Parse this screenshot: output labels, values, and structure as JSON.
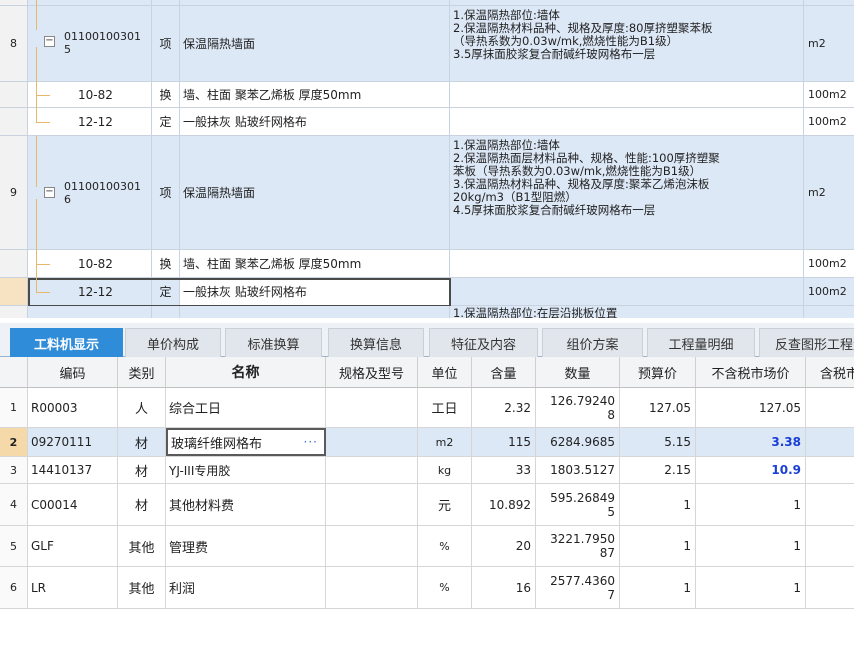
{
  "upper_grid": {
    "top_unit": "m2",
    "rows": [
      {
        "type": "qd",
        "no": "8",
        "code": "011001003015",
        "code_line1": "01100100301",
        "code_line2": "5",
        "cat": "项",
        "name": "保温隔热墙面",
        "features": [
          "1.保温隔热部位:墙体",
          "2.保温隔热材料品种、规格及厚度:80厚挤塑聚苯板",
          "（导热系数为0.03w/mk,燃烧性能为B1级）",
          "3.5厚抹面胶浆复合耐碱纤玻网格布一层"
        ],
        "unit": "m2"
      },
      {
        "type": "de",
        "code": "10-82",
        "cat": "换",
        "name": "墙、柱面 聚苯乙烯板 厚度50mm",
        "unit": "100m2"
      },
      {
        "type": "de",
        "code": "12-12",
        "cat": "定",
        "name": "一般抹灰 贴玻纤网格布",
        "unit": "100m2"
      },
      {
        "type": "qd",
        "no": "9",
        "code_line1": "01100100301",
        "code_line2": "6",
        "cat": "项",
        "name": "保温隔热墙面",
        "features": [
          "1.保温隔热部位:墙体",
          "2.保温隔热面层材料品种、规格、性能:100厚挤塑聚",
          "苯板（导热系数为0.03w/mk,燃烧性能为B1级）",
          "3.保温隔热材料品种、规格及厚度:聚苯乙烯泡沫板",
          "20kg/m3（B1型阻燃）",
          "4.5厚抹面胶浆复合耐碱纤玻网格布一层"
        ],
        "unit": "m2"
      },
      {
        "type": "de",
        "code": "10-82",
        "cat": "换",
        "name": "墙、柱面 聚苯乙烯板 厚度50mm",
        "unit": "100m2"
      },
      {
        "type": "sel",
        "code": "12-12",
        "cat": "定",
        "name": "一般抹灰 贴玻纤网格布",
        "unit": "100m2"
      }
    ],
    "partial_next": "1.保温隔热部位:在层沿挑板位置"
  },
  "tabs": [
    "工料机显示",
    "单价构成",
    "标准换算",
    "换算信息",
    "特征及内容",
    "组价方案",
    "工程量明细",
    "反查图形工程量"
  ],
  "lower_grid": {
    "headers": [
      "编码",
      "类别",
      "名称",
      "规格及型号",
      "单位",
      "含量",
      "数量",
      "预算价",
      "不含税市场价",
      "含税市场价"
    ],
    "rows": [
      {
        "rn": "1",
        "code": "R00003",
        "cat": "人",
        "name": "综合工日",
        "spec": "",
        "unit": "工日",
        "qty": "2.32",
        "amount": "126.792408",
        "amount_l1": "126.79240",
        "amount_l2": "8",
        "budget": "127.05",
        "market": "127.05"
      },
      {
        "rn": "2",
        "code": "09270111",
        "cat": "材",
        "name": "玻璃纤维网格布",
        "spec": "",
        "unit": "m2",
        "qty": "115",
        "amount": "6284.9685",
        "budget": "5.15",
        "market": "3.38"
      },
      {
        "rn": "3",
        "code": "14410137",
        "cat": "材",
        "name": "YJ-III专用胶",
        "spec": "",
        "unit": "kg",
        "qty": "33",
        "amount": "1803.5127",
        "budget": "2.15",
        "market": "10.9"
      },
      {
        "rn": "4",
        "code": "C00014",
        "cat": "材",
        "name": "其他材料费",
        "spec": "",
        "unit": "元",
        "qty": "10.892",
        "amount": "595.268495",
        "amount_l1": "595.26849",
        "amount_l2": "5",
        "budget": "1",
        "market": "1"
      },
      {
        "rn": "5",
        "code": "GLF",
        "cat": "其他",
        "name": "管理费",
        "spec": "",
        "unit": "%",
        "qty": "20",
        "amount": "3221.795087",
        "amount_l1": "3221.7950",
        "amount_l2": "87",
        "budget": "1",
        "market": "1"
      },
      {
        "rn": "6",
        "code": "LR",
        "cat": "其他",
        "name": "利润",
        "spec": "",
        "unit": "%",
        "qty": "16",
        "amount": "2577.43607",
        "amount_l1": "2577.4360",
        "amount_l2": "7",
        "budget": "1",
        "market": "1"
      }
    ],
    "edit_dots": "···"
  },
  "colors": {
    "accent": "#2f8cd8",
    "selected_row": "#dde8f7",
    "highlight_value": "#1a3fd6",
    "tree_line": "#e6b96a"
  }
}
